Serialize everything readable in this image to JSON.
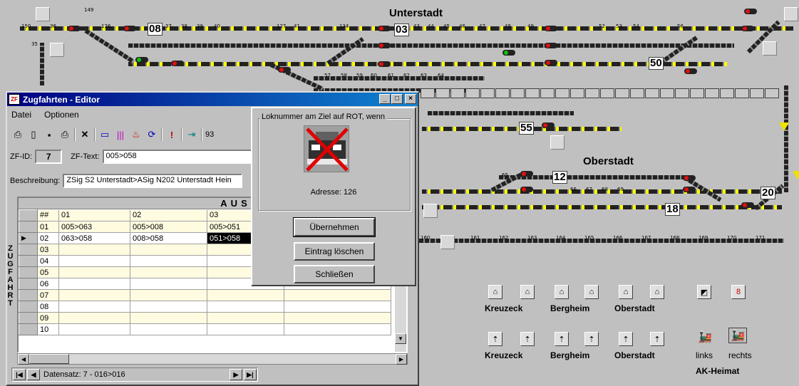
{
  "layout": {
    "title_top": "Unterstadt",
    "title_mid": "Oberstadt",
    "blocks": [
      "08",
      "03",
      "50",
      "55",
      "12",
      "20",
      "18"
    ],
    "track_numbers": [
      "150",
      "149",
      "36",
      "35",
      "126",
      "127",
      "37",
      "38",
      "39",
      "40",
      "41",
      "134",
      "43",
      "44",
      "45",
      "46",
      "47",
      "48",
      "49",
      "52",
      "53",
      "54",
      "56",
      "57",
      "58",
      "59",
      "60",
      "61",
      "62",
      "63",
      "64",
      "65",
      "66",
      "67",
      "68",
      "69",
      "160",
      "161",
      "162",
      "163",
      "164",
      "165",
      "166",
      "167",
      "168",
      "169",
      "170",
      "171"
    ]
  },
  "panel": {
    "stations_row1": [
      "Kreuzeck",
      "Bergheim",
      "Oberstadt"
    ],
    "stations_row2": [
      "Kreuzeck",
      "Bergheim",
      "Oberstadt"
    ],
    "loco_left": "links",
    "loco_right": "rechts",
    "group": "AK-Heimat"
  },
  "editor": {
    "title": "Zugfahrten - Editor",
    "menu": [
      "Datei",
      "Optionen"
    ],
    "toolbar_value": "93",
    "zf_id_label": "ZF-ID:",
    "zf_id_value": "7",
    "zf_text_label": "ZF-Text:",
    "zf_text_value": "005>058",
    "desc_label": "Beschreibung:",
    "desc_value": "ZSig S2 Unterstadt>ASig N202 Unterstadt Hein",
    "grid_header": "AUSWEICH-W",
    "columns": [
      "##",
      "01",
      "02",
      "03"
    ],
    "rows": [
      {
        "id": "01",
        "c1": "005>063",
        "c2": "005>008",
        "c3": "005>051"
      },
      {
        "id": "02",
        "c1": "063>058",
        "c2": "008>058",
        "c3": "051>058"
      },
      {
        "id": "03",
        "c1": "",
        "c2": "",
        "c3": ""
      },
      {
        "id": "04",
        "c1": "",
        "c2": "",
        "c3": ""
      },
      {
        "id": "05",
        "c1": "",
        "c2": "",
        "c3": ""
      },
      {
        "id": "06",
        "c1": "",
        "c2": "",
        "c3": ""
      },
      {
        "id": "07",
        "c1": "",
        "c2": "",
        "c3": ""
      },
      {
        "id": "08",
        "c1": "",
        "c2": "",
        "c3": ""
      },
      {
        "id": "09",
        "c1": "",
        "c2": "",
        "c3": ""
      },
      {
        "id": "10",
        "c1": "",
        "c2": "",
        "c3": ""
      }
    ],
    "vertical_label": "ZUGFAHRT",
    "record_label": "Datensatz: 7 - 016>016"
  },
  "dialog": {
    "group_title": "Loknummer am Ziel auf ROT, wenn",
    "address": "Adresse: 126",
    "btn_apply": "Übernehmen",
    "btn_delete": "Eintrag löschen",
    "btn_close": "Schließen"
  },
  "colors": {
    "title_blue": "#000080",
    "track_yellow": "#ffff00",
    "signal_red": "#e01010"
  }
}
